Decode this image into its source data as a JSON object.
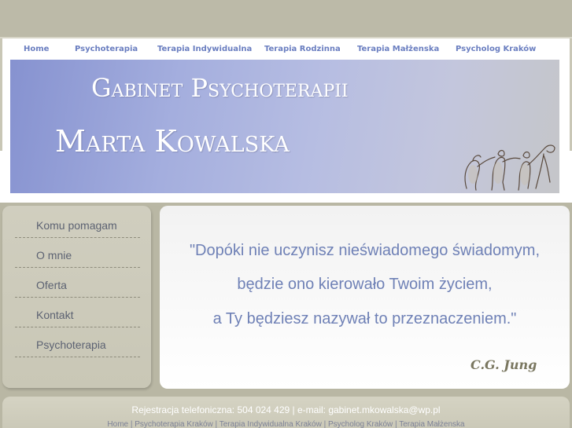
{
  "nav": {
    "items": [
      {
        "label": "Home"
      },
      {
        "label": "Psychoterapia"
      },
      {
        "label": "Terapia Indywidualna"
      },
      {
        "label": "Terapia Rodzinna"
      },
      {
        "label": "Terapia Małżenska"
      },
      {
        "label": "Psycholog Kraków"
      }
    ]
  },
  "banner": {
    "line1": "Gabinet Psychoterapii",
    "line2": "Marta Kowalska"
  },
  "sidebar": {
    "items": [
      {
        "label": "Komu pomagam"
      },
      {
        "label": "O mnie"
      },
      {
        "label": "Oferta"
      },
      {
        "label": "Kontakt"
      },
      {
        "label": "Psychoterapia"
      }
    ]
  },
  "quote": {
    "lines": [
      "\"Dopóki nie uczynisz nieświadomego świadomym,",
      "będzie ono kierowało Twoim życiem,",
      "a Ty będziesz nazywał to przeznaczeniem.\""
    ],
    "author": "C.G. Jung"
  },
  "footer": {
    "contact": "Rejestracja telefoniczna: 504 024 429 | e-mail: gabinet.mkowalska@wp.pl",
    "links": [
      {
        "label": "Home"
      },
      {
        "label": "Psychoterapia Kraków"
      },
      {
        "label": "Terapia Indywidualna Kraków"
      },
      {
        "label": "Psycholog Kraków"
      },
      {
        "label": "Terapia Małżenska"
      }
    ],
    "separator": " | "
  },
  "colors": {
    "nav_link": "#6a7ec0",
    "quote_text": "#6f81b6",
    "sidebar_bg": "#cbc9b8",
    "page_bg": "#b9b7a4"
  }
}
